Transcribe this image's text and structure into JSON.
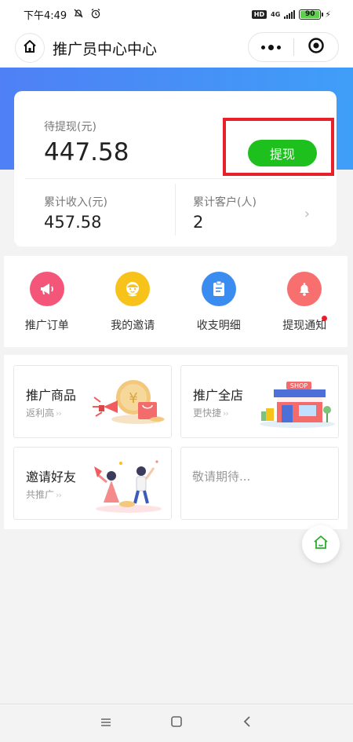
{
  "status_bar": {
    "time": "下午4:49",
    "network": "4G",
    "hd": "HD",
    "battery": "90"
  },
  "nav": {
    "title": "推广员中心中心"
  },
  "balance": {
    "label": "待提现(元)",
    "value": "447.58",
    "withdraw_label": "提现",
    "total_income_label": "累计收入(元)",
    "total_income_value": "457.58",
    "total_customers_label": "累计客户(人)",
    "total_customers_value": "2"
  },
  "quick_menu": [
    {
      "label": "推广订单",
      "icon": "megaphone-icon",
      "color": "#f4567a"
    },
    {
      "label": "我的邀请",
      "icon": "smile-icon",
      "color": "#f7c21a"
    },
    {
      "label": "收支明细",
      "icon": "clipboard-icon",
      "color": "#3b8cf0"
    },
    {
      "label": "提现通知",
      "icon": "bell-icon",
      "color": "#f76f6f"
    }
  ],
  "promo": [
    {
      "title": "推广商品",
      "subtitle": "返利高"
    },
    {
      "title": "推广全店",
      "subtitle": "更快捷"
    },
    {
      "title": "邀请好友",
      "subtitle": "共推广"
    },
    {
      "title": "敬请期待..."
    }
  ],
  "shop_sign": "SHOP",
  "colors": {
    "accent_blue": "#4f80f5",
    "withdraw_green": "#1ec01e",
    "highlight_red": "#e8202a"
  }
}
